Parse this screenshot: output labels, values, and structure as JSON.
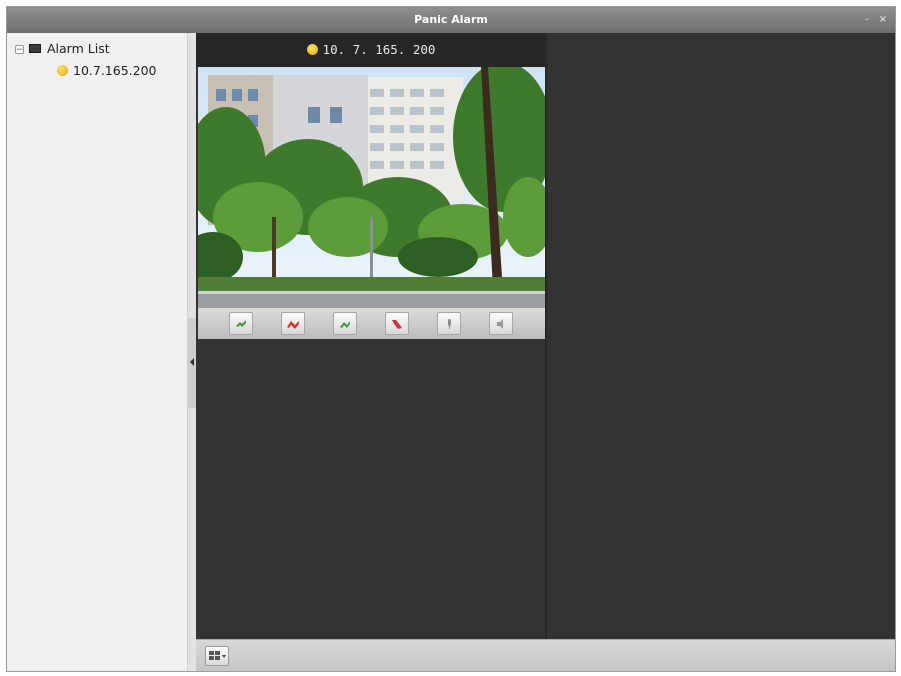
{
  "window": {
    "title": "Panic Alarm",
    "minimize_glyph": "–",
    "close_glyph": "×"
  },
  "tree": {
    "root_label": "Alarm List",
    "root_toggle": "−",
    "root_icon": "monitor-icon",
    "children": [
      {
        "label": "10.7.165.200",
        "icon": "alarm-status-icon",
        "status_color": "#f1c21b"
      }
    ]
  },
  "video": {
    "channel_label": "10. 7. 165. 200",
    "ptz_buttons": [
      {
        "icon": "call-answer-icon",
        "color": "#3c9a3c"
      },
      {
        "icon": "call-hangup-icon",
        "color": "#c63b3b"
      },
      {
        "icon": "call-answer-alt-icon",
        "color": "#3c9a3c"
      },
      {
        "icon": "alarm-stop-icon",
        "color": "#c63b3b"
      },
      {
        "icon": "microphone-icon",
        "color": "#7a7a7a"
      },
      {
        "icon": "speaker-icon",
        "color": "#7a7a7a"
      }
    ]
  },
  "bottom_bar": {
    "layout_button_icon": "window-layout-icon"
  },
  "colors": {
    "title_bar": "#7a7a7a",
    "video_area": "#333333",
    "sidebar": "#f0f0f0",
    "status_yellow": "#f1c21b"
  }
}
